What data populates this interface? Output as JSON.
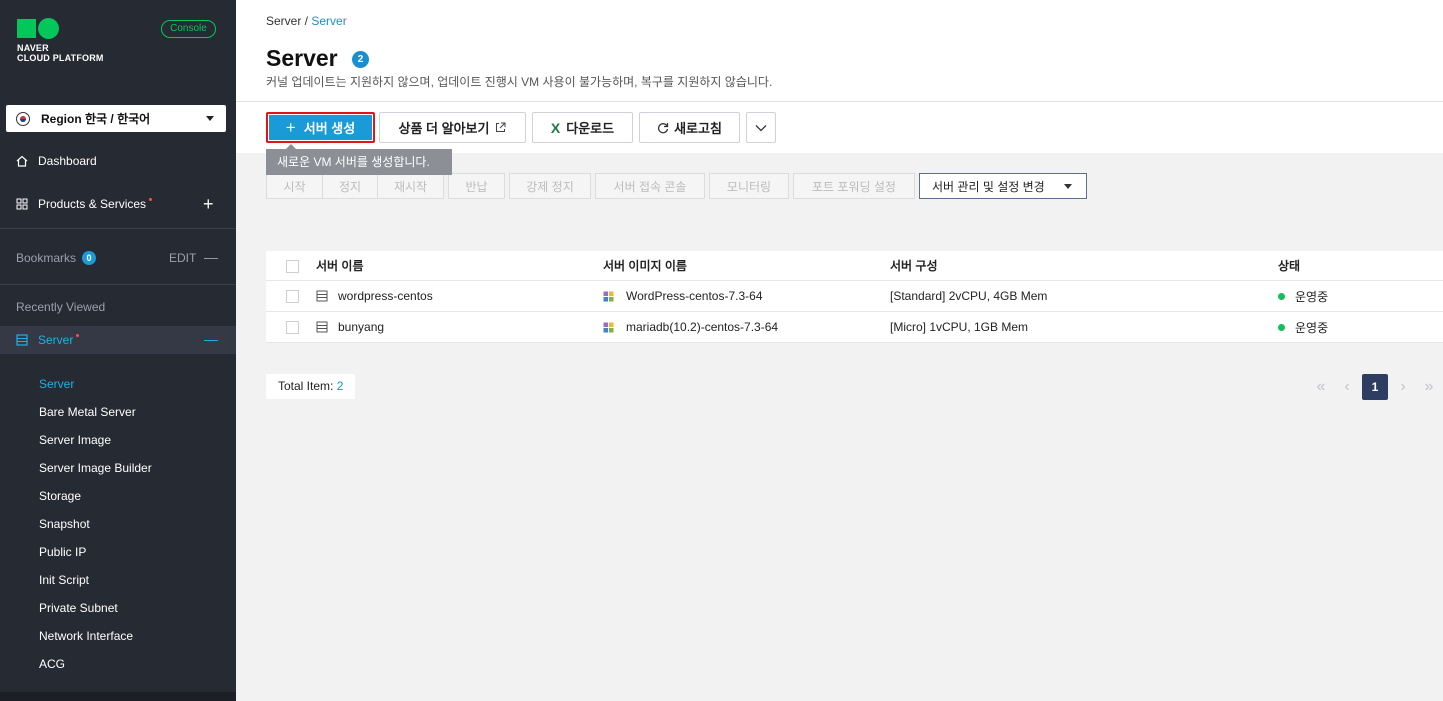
{
  "brand": {
    "line1": "NAVER",
    "line2": "CLOUD PLATFORM",
    "console_label": "Console"
  },
  "sidebar": {
    "region_label": "Region 한국 / 한국어",
    "dashboard": "Dashboard",
    "products": "Products & Services",
    "bookmarks": "Bookmarks",
    "bookmarks_count": "0",
    "edit": "EDIT",
    "recently_viewed": "Recently Viewed",
    "server_group": "Server",
    "items": [
      {
        "label": "Server",
        "active": true
      },
      {
        "label": "Bare Metal Server"
      },
      {
        "label": "Server Image"
      },
      {
        "label": "Server Image Builder"
      },
      {
        "label": "Storage"
      },
      {
        "label": "Snapshot"
      },
      {
        "label": "Public IP"
      },
      {
        "label": "Init Script"
      },
      {
        "label": "Private Subnet"
      },
      {
        "label": "Network Interface"
      },
      {
        "label": "ACG"
      }
    ]
  },
  "header": {
    "breadcrumb_root": "Server /",
    "breadcrumb_current": "Server",
    "title": "Server",
    "count": "2",
    "description": "커널 업데이트는 지원하지 않으며, 업데이트 진행시 VM 사용이 불가능하며, 복구를 지원하지 않습니다."
  },
  "toolbar": {
    "create": "서버 생성",
    "learn_more": "상품 더 알아보기",
    "download": "다운로드",
    "refresh": "새로고침",
    "tooltip": "새로운 VM 서버를 생성합니다."
  },
  "actions": [
    "시작",
    "정지",
    "재시작",
    "반납",
    "강제 정지",
    "서버 접속 콘솔",
    "모니터링",
    "포트 포워딩 설정"
  ],
  "manage_label": "서버 관리 및 설정 변경",
  "table": {
    "headers": [
      "서버 이름",
      "서버 이미지 이름",
      "서버 구성",
      "상태"
    ],
    "rows": [
      {
        "name": "wordpress-centos",
        "image": "WordPress-centos-7.3-64",
        "spec": "[Standard] 2vCPU, 4GB Mem",
        "status": "운영중"
      },
      {
        "name": "bunyang",
        "image": "mariadb(10.2)-centos-7.3-64",
        "spec": "[Micro] 1vCPU, 1GB Mem",
        "status": "운영중"
      }
    ]
  },
  "footer": {
    "total_label": "Total Item:",
    "total_value": "2",
    "current_page": "1"
  },
  "colors": {
    "accent": "#1a9bd7",
    "sidebar_bg": "#262a33",
    "brand_green": "#03c75a",
    "running": "#10c15a",
    "highlight_border": "#e2131a"
  }
}
